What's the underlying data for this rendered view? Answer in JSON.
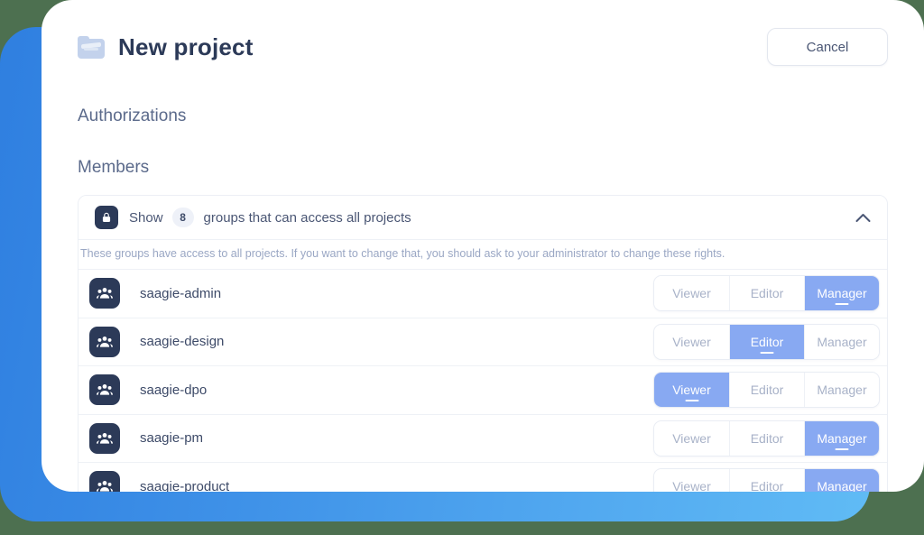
{
  "theme": {
    "page_background": "#4d7050",
    "slab_gradient_from": "#2f7fe0",
    "slab_gradient_to": "#60bbf5",
    "card_background": "#ffffff",
    "accent_active": "#88a9f2",
    "text_dark": "#2c3a58",
    "text_muted": "#9aa7c4"
  },
  "header": {
    "folder_icon": "folder-icon",
    "title": "New project",
    "cancel_label": "Cancel"
  },
  "sections": {
    "authorizations": "Authorizations",
    "members": "Members"
  },
  "groups_panel": {
    "lock_icon": "lock-icon",
    "show_label": "Show",
    "count": "8",
    "rest_label": "groups that can access all projects",
    "chevron_icon": "chevron-up-icon",
    "note": "These groups have access to all projects. If you want to change that, you should ask to your administrator to change these rights."
  },
  "roles": [
    "Viewer",
    "Editor",
    "Manager"
  ],
  "members": [
    {
      "avatar_icon": "group-icon",
      "name": "saagie-admin",
      "role": "Manager"
    },
    {
      "avatar_icon": "group-icon",
      "name": "saagie-design",
      "role": "Editor"
    },
    {
      "avatar_icon": "group-icon",
      "name": "saagie-dpo",
      "role": "Viewer"
    },
    {
      "avatar_icon": "group-icon",
      "name": "saagie-pm",
      "role": "Manager"
    },
    {
      "avatar_icon": "group-icon",
      "name": "saagie-product",
      "role": "Manager"
    }
  ]
}
